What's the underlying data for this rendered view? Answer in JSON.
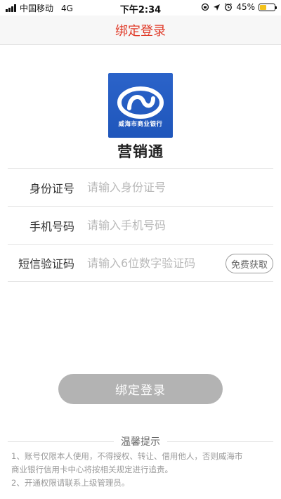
{
  "status_bar": {
    "carrier": "中国移动",
    "network": "4G",
    "time": "下午2:34",
    "battery": "45%",
    "battery_level": 0.45
  },
  "nav": {
    "title": "绑定登录"
  },
  "logo": {
    "bank_name": "威海市商业银行"
  },
  "app": {
    "name": "营销通"
  },
  "form": {
    "id_label": "身份证号",
    "id_placeholder": "请输入身份证号",
    "phone_label": "手机号码",
    "phone_placeholder": "请输入手机号码",
    "sms_label": "短信验证码",
    "sms_placeholder": "请输入6位数字验证码",
    "get_code_label": "免费获取"
  },
  "submit": {
    "label": "绑定登录"
  },
  "tips": {
    "title": "温馨提示",
    "item1_line1": "1、账号仅限本人使用，不得授权、转让、借用他人，否则威海市",
    "item1_line2": "商业银行信用卡中心将按相关规定进行追责。",
    "item2": "2、开通权限请联系上级管理员。"
  },
  "colors": {
    "title_red": "#e03a28",
    "logo_blue": "#2359c2",
    "button_gray": "#b3b3b3"
  }
}
